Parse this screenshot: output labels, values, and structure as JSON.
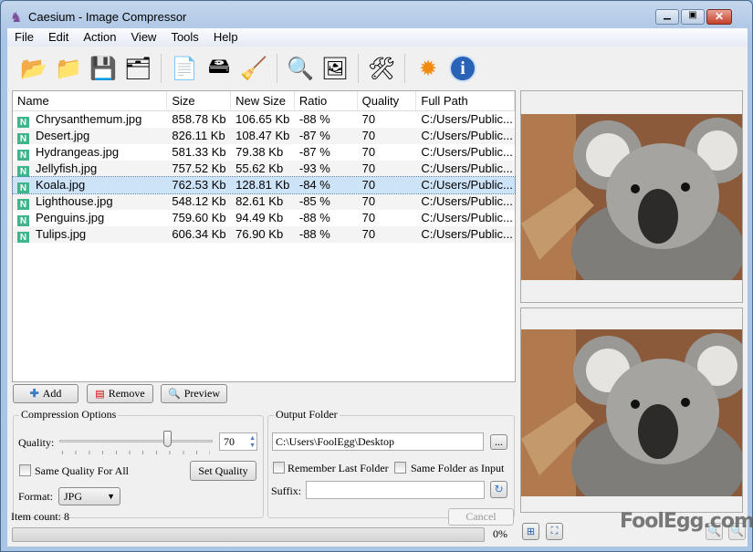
{
  "window": {
    "title": "Caesium - Image Compressor"
  },
  "menu": [
    "File",
    "Edit",
    "Action",
    "View",
    "Tools",
    "Help"
  ],
  "toolbar": [
    {
      "icon": "open-file-icon"
    },
    {
      "icon": "open-folder-icon"
    },
    {
      "icon": "save-list-icon"
    },
    {
      "icon": "open-list-icon"
    },
    {
      "icon": "remove-item-icon"
    },
    {
      "icon": "remove-all-icon"
    },
    {
      "icon": "clear-broom-icon"
    },
    {
      "icon": "preview-magnifier-icon"
    },
    {
      "icon": "compress-image-icon"
    },
    {
      "icon": "settings-tools-icon"
    },
    {
      "icon": "update-icon"
    },
    {
      "icon": "info-icon"
    }
  ],
  "table": {
    "columns": [
      "Name",
      "Size",
      "New Size",
      "Ratio",
      "Quality",
      "Full Path"
    ],
    "rows": [
      [
        "Chrysanthemum.jpg",
        "858.78 Kb",
        "106.65 Kb",
        "-88 %",
        "70",
        "C:/Users/Public..."
      ],
      [
        "Desert.jpg",
        "826.11 Kb",
        "108.47 Kb",
        "-87 %",
        "70",
        "C:/Users/Public..."
      ],
      [
        "Hydrangeas.jpg",
        "581.33 Kb",
        "79.38 Kb",
        "-87 %",
        "70",
        "C:/Users/Public..."
      ],
      [
        "Jellyfish.jpg",
        "757.52 Kb",
        "55.62 Kb",
        "-93 %",
        "70",
        "C:/Users/Public..."
      ],
      [
        "Koala.jpg",
        "762.53 Kb",
        "128.81 Kb",
        "-84 %",
        "70",
        "C:/Users/Public..."
      ],
      [
        "Lighthouse.jpg",
        "548.12 Kb",
        "82.61 Kb",
        "-85 %",
        "70",
        "C:/Users/Public..."
      ],
      [
        "Penguins.jpg",
        "759.60 Kb",
        "94.49 Kb",
        "-88 %",
        "70",
        "C:/Users/Public..."
      ],
      [
        "Tulips.jpg",
        "606.34 Kb",
        "76.90 Kb",
        "-88 %",
        "70",
        "C:/Users/Public..."
      ]
    ],
    "selected": 4,
    "file_badge": "N"
  },
  "buttons": {
    "add": "Add",
    "remove": "Remove",
    "preview": "Preview",
    "set_quality": "Set Quality",
    "cancel": "Cancel",
    "browse": "..."
  },
  "compression": {
    "title": "Compression Options",
    "quality_label": "Quality:",
    "quality": "70",
    "quality_max": 100,
    "same_quality": "Same Quality For All",
    "format_label": "Format:",
    "format": "JPG"
  },
  "output": {
    "title": "Output Folder",
    "path": "C:\\Users\\FoolEgg\\Desktop",
    "remember": "Remember Last Folder",
    "same_folder": "Same Folder as Input",
    "suffix_label": "Suffix:",
    "suffix": ""
  },
  "status": {
    "item_count": "Item count: 8",
    "progress": "0%",
    "progress_value": 0
  },
  "watermark": "FoolEgg.com"
}
